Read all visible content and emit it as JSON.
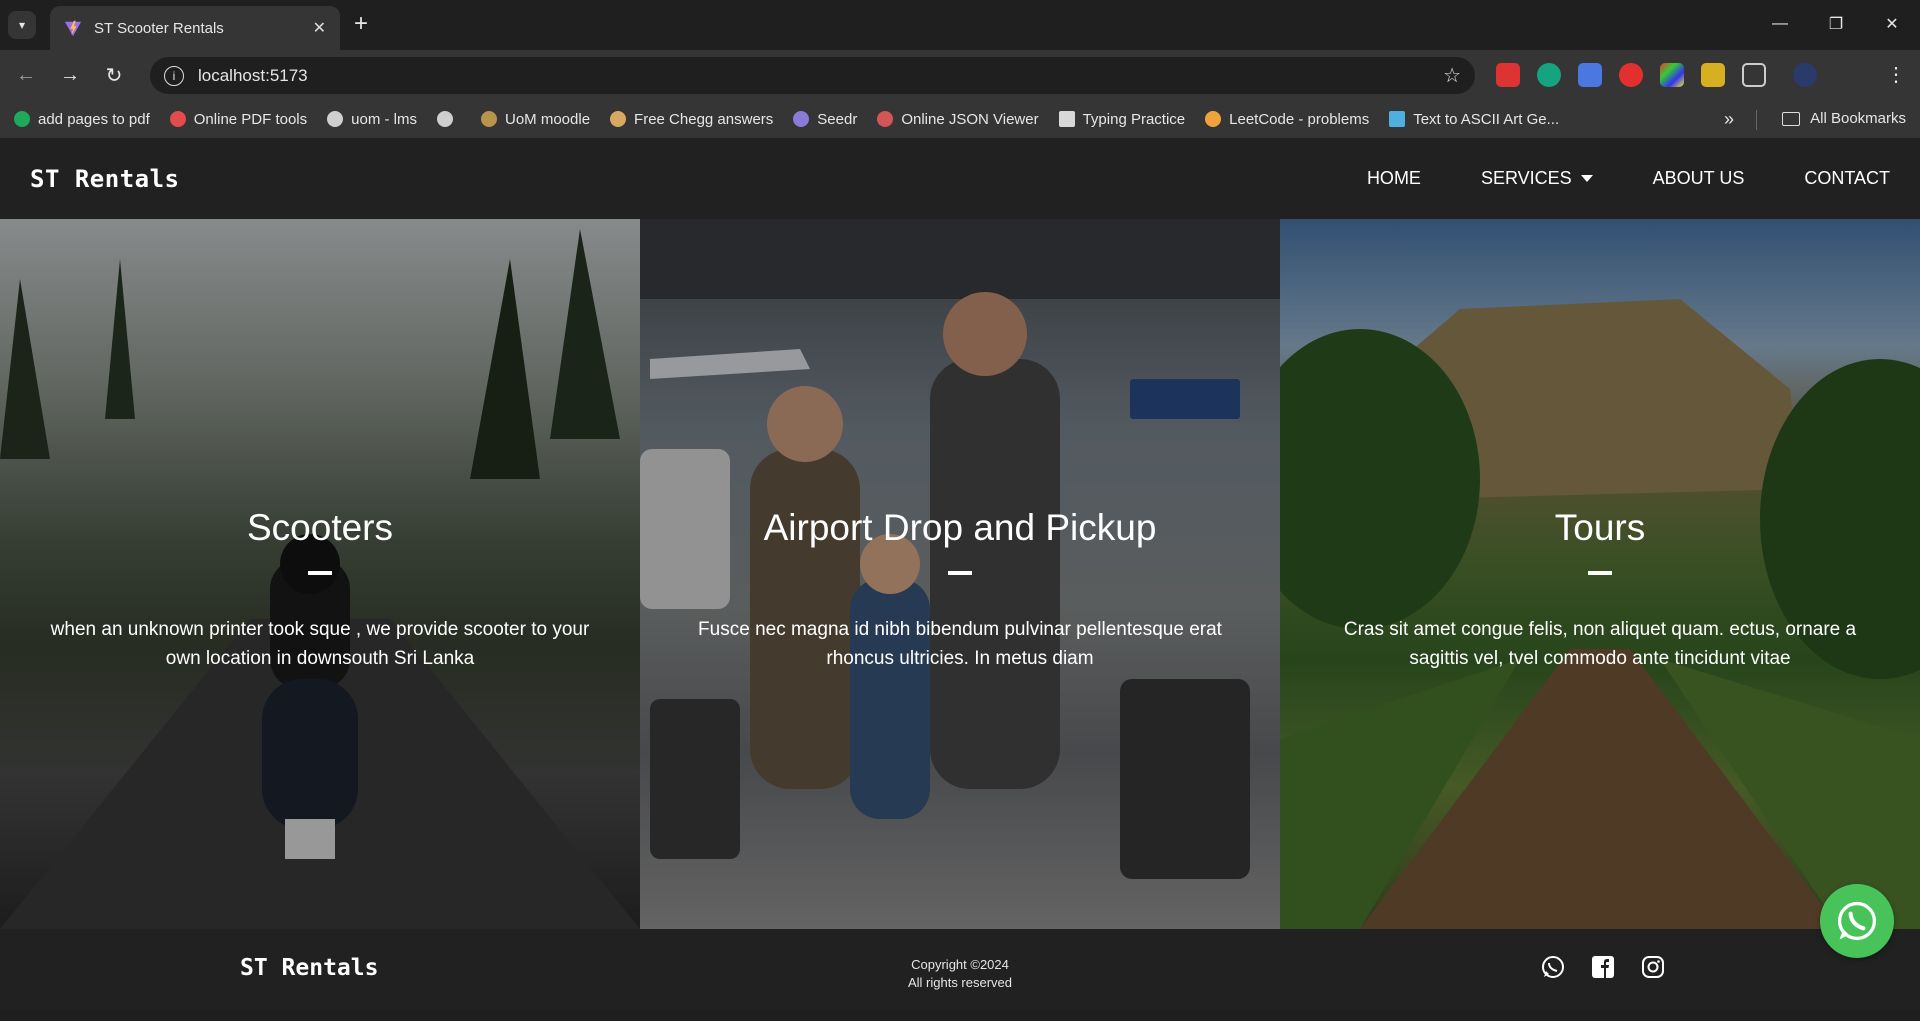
{
  "browser": {
    "tab_title": "ST Scooter Rentals",
    "url": "localhost:5173",
    "bookmarks": [
      {
        "label": "add pages to pdf",
        "color": "#1ea95b"
      },
      {
        "label": "Online PDF tools",
        "color": "#e34c4c"
      },
      {
        "label": "uom - lms",
        "color": "#cfcfcf"
      },
      {
        "label": "",
        "color": "#cfcfcf"
      },
      {
        "label": "UoM moodle",
        "color": "#b8934a"
      },
      {
        "label": "Free Chegg answers",
        "color": "#d9a860"
      },
      {
        "label": "Seedr",
        "color": "#8b7ad8"
      },
      {
        "label": "Online JSON Viewer",
        "color": "#d25656"
      },
      {
        "label": "Typing Practice",
        "color": "#d8d8d8"
      },
      {
        "label": "LeetCode - problems",
        "color": "#f0a33a"
      },
      {
        "label": "Text to ASCII Art Ge...",
        "color": "#4fb0e0"
      }
    ],
    "all_bookmarks": "All Bookmarks"
  },
  "site": {
    "logo": "ST Rentals",
    "nav": {
      "home": "HOME",
      "services": "SERVICES",
      "about": "ABOUT US",
      "contact": "CONTACT"
    },
    "panels": [
      {
        "title": "Scooters",
        "text": "when an unknown printer took sque , we provide scooter to your own location in downsouth Sri Lanka"
      },
      {
        "title": "Airport Drop and Pickup",
        "text": "Fusce nec magna id nibh bibendum pulvinar pellentesque erat rhoncus ultricies. In metus diam"
      },
      {
        "title": "Tours",
        "text": "Cras sit amet congue felis, non aliquet quam. ectus, ornare a sagittis vel, tvel commodo ante tincidunt vitae"
      }
    ],
    "footer": {
      "logo": "ST Rentals",
      "copyright": "Copyright ©2024",
      "rights": "All rights reserved"
    }
  },
  "colors": {
    "whatsapp": "#48c35a",
    "nav_bg": "#212121"
  }
}
